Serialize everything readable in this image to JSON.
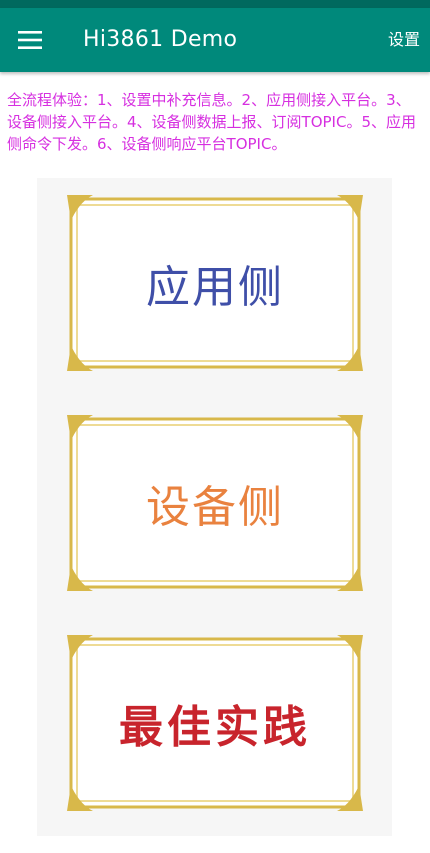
{
  "app_bar": {
    "title": "Hi3861 Demo",
    "menu_icon": "hamburger-menu-icon",
    "settings_label": "设置"
  },
  "description": "全流程体验：1、设置中补充信息。2、应用侧接入平台。3、设备侧接入平台。4、设备侧数据上报、订阅TOPIC。5、应用侧命令下发。6、设备侧响应平台TOPIC。",
  "cards": [
    {
      "label": "应用侧",
      "color": "#3f4fa8"
    },
    {
      "label": "设备侧",
      "color": "#e9823f"
    },
    {
      "label": "最佳实践",
      "color": "#c8242c"
    }
  ],
  "colors": {
    "app_bar": "#00897b",
    "status_bar": "#00695e",
    "description_text": "#d62fe0",
    "frame_gold": "#d8b84a"
  }
}
